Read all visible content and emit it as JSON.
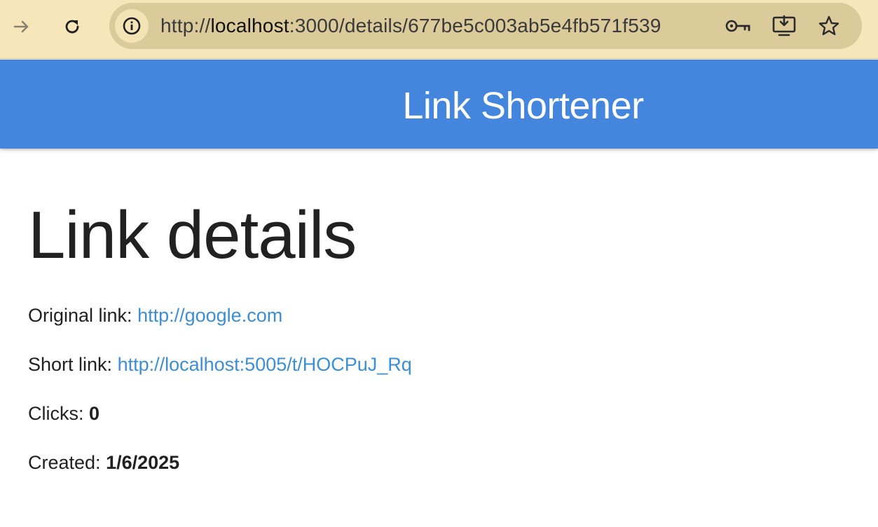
{
  "browser": {
    "url_prefix": "http://",
    "url_host": "localhost",
    "url_rest": ":3000/details/677be5c003ab5e4fb571f539",
    "icons": {
      "forward": "arrow-forward-icon",
      "reload": "reload-icon",
      "site_info": "info-icon",
      "password": "key-icon",
      "install": "install-app-icon",
      "bookmark": "star-icon"
    }
  },
  "header": {
    "title": "Link Shortener",
    "color": "#4486dd"
  },
  "main": {
    "title": "Link details",
    "original": {
      "label": "Original link:",
      "value": "http://google.com"
    },
    "short": {
      "label": "Short link:",
      "value": "http://localhost:5005/t/HOCPuJ_Rq"
    },
    "clicks": {
      "label": "Clicks:",
      "value": "0"
    },
    "created": {
      "label": "Created:",
      "value": "1/6/2025"
    },
    "link_color": "#3b8fd9"
  }
}
